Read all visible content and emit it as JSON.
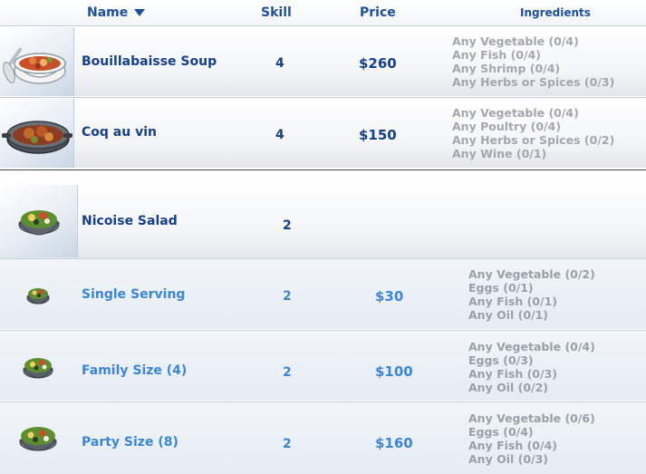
{
  "header": {
    "name": "Name",
    "sort_icon": "sort-descending-icon",
    "skill": "Skill",
    "price": "Price",
    "ingredients": "Ingredients"
  },
  "recipes_top": [
    {
      "name": "Bouillabaisse Soup",
      "skill": "4",
      "price": "$260",
      "icon": "soup-bowl-icon",
      "ingredients": [
        "Any Vegetable (0/4)",
        "Any Fish (0/4)",
        "Any Shrimp (0/4)",
        "Any Herbs or Spices (0/3)"
      ]
    },
    {
      "name": "Coq au vin",
      "skill": "4",
      "price": "$150",
      "icon": "stew-pan-icon",
      "ingredients": [
        "Any Vegetable (0/4)",
        "Any Poultry (0/4)",
        "Any Herbs or Spices (0/2)",
        "Any Wine (0/1)"
      ]
    }
  ],
  "group": {
    "name": "Nicoise Salad",
    "skill": "2",
    "icon": "salad-bowl-icon"
  },
  "servings": [
    {
      "name": "Single Serving",
      "skill": "2",
      "price": "$30",
      "icon": "salad-bowl-icon",
      "ingredients": [
        "Any Vegetable (0/2)",
        "Eggs (0/1)",
        "Any Fish (0/1)",
        "Any Oil (0/1)"
      ]
    },
    {
      "name": "Family Size (4)",
      "skill": "2",
      "price": "$100",
      "icon": "salad-bowl-icon",
      "ingredients": [
        "Any Vegetable (0/4)",
        "Eggs (0/3)",
        "Any Fish (0/3)",
        "Any Oil (0/2)"
      ]
    },
    {
      "name": "Party Size (8)",
      "skill": "2",
      "price": "$160",
      "icon": "salad-bowl-icon",
      "ingredients": [
        "Any Vegetable (0/6)",
        "Eggs (0/4)",
        "Any Fish (0/4)",
        "Any Oil (0/3)"
      ]
    }
  ],
  "colors": {
    "title_blue": "#17408b",
    "serving_blue": "#3b86d8",
    "ingredient_gray": "#a3a8ae"
  }
}
